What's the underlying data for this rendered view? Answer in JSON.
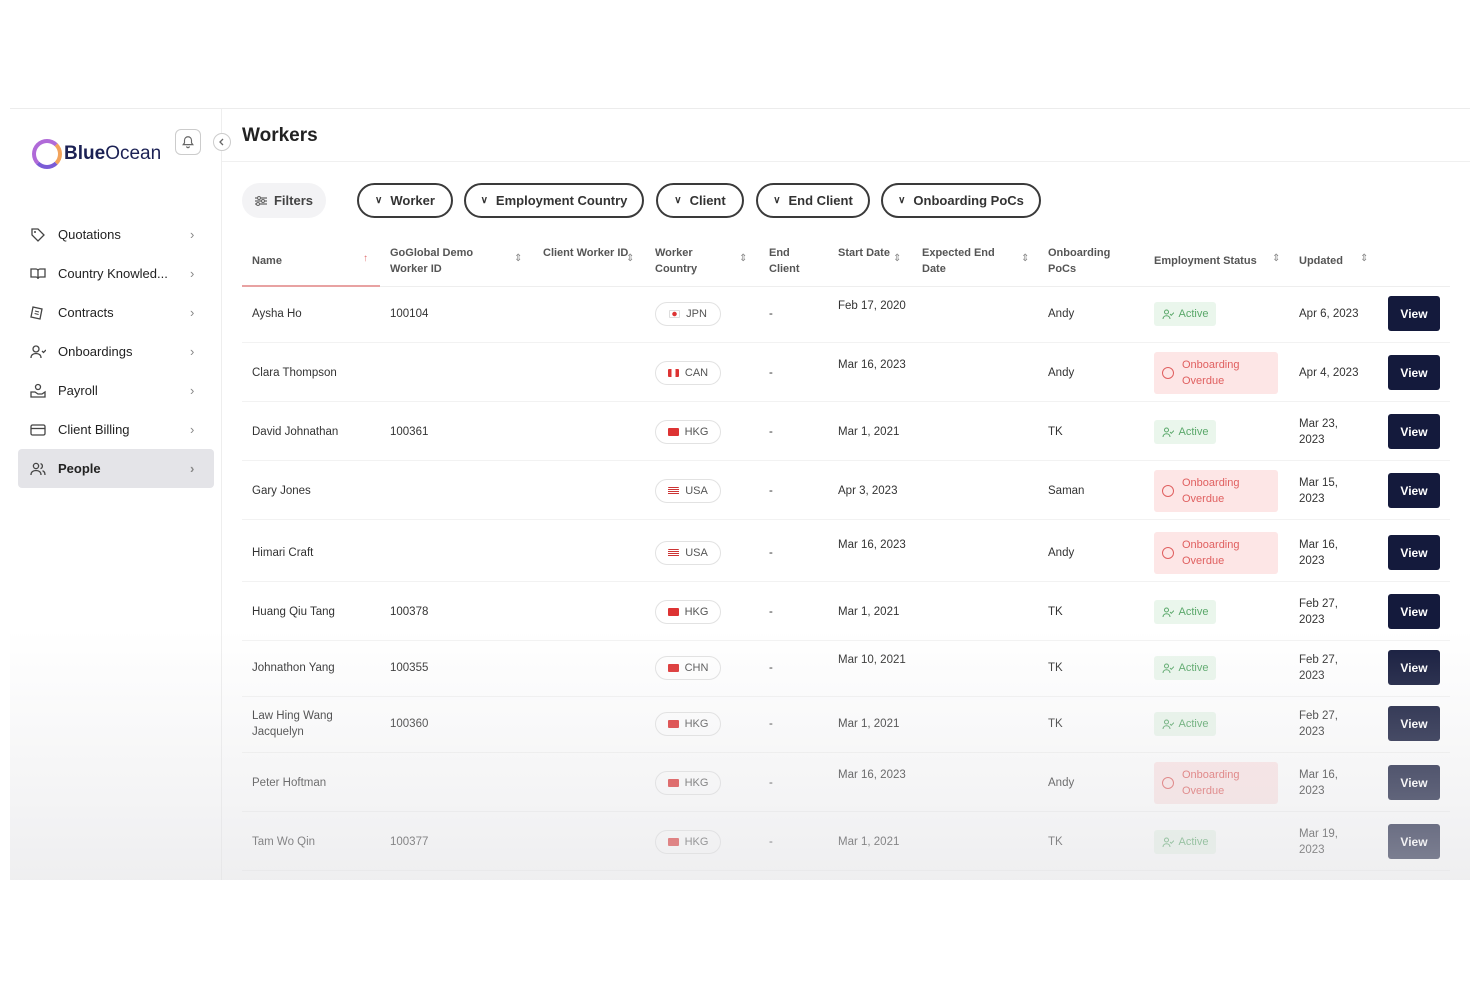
{
  "brand": {
    "name_bold": "Blue",
    "name_light": "Ocean"
  },
  "sidebar": {
    "items": [
      {
        "label": "Quotations",
        "icon": "tag-icon",
        "active": false
      },
      {
        "label": "Country Knowled...",
        "icon": "book-icon",
        "active": false
      },
      {
        "label": "Contracts",
        "icon": "contract-icon",
        "active": false
      },
      {
        "label": "Onboardings",
        "icon": "user-plus-icon",
        "active": false
      },
      {
        "label": "Payroll",
        "icon": "payroll-icon",
        "active": false
      },
      {
        "label": "Client Billing",
        "icon": "card-icon",
        "active": false
      },
      {
        "label": "People",
        "icon": "people-icon",
        "active": true
      }
    ]
  },
  "page": {
    "title": "Workers"
  },
  "filters": {
    "label": "Filters",
    "buttons": [
      "Worker",
      "Employment Country",
      "Client",
      "End Client",
      "Onboarding PoCs"
    ]
  },
  "table": {
    "headers": [
      "Name",
      "GoGlobal Demo Worker ID",
      "Client Worker ID",
      "Worker Country",
      "End Client",
      "Start Date",
      "Expected End Date",
      "Onboarding PoCs",
      "Employment Status",
      "Updated"
    ],
    "view_label": "View",
    "rows": [
      {
        "name": "Aysha Ho",
        "worker_id": "100104",
        "client_worker_id": "",
        "country": "JPN",
        "end_client": "-",
        "start_date": "Feb 17, 2020",
        "expected_end": "",
        "pocs": "Andy",
        "status": "Active",
        "updated": "Apr 6, 2023"
      },
      {
        "name": "Clara Thompson",
        "worker_id": "",
        "client_worker_id": "",
        "country": "CAN",
        "end_client": "-",
        "start_date": "Mar 16, 2023",
        "expected_end": "",
        "pocs": "Andy",
        "status": "Onboarding Overdue",
        "updated": "Apr 4, 2023"
      },
      {
        "name": "David Johnathan",
        "worker_id": "100361",
        "client_worker_id": "",
        "country": "HKG",
        "end_client": "-",
        "start_date": "Mar 1, 2021",
        "expected_end": "",
        "pocs": "TK",
        "status": "Active",
        "updated": "Mar 23, 2023"
      },
      {
        "name": "Gary Jones",
        "worker_id": "",
        "client_worker_id": "",
        "country": "USA",
        "end_client": "-",
        "start_date": "Apr 3, 2023",
        "expected_end": "",
        "pocs": "Saman",
        "status": "Onboarding Overdue",
        "updated": "Mar 15, 2023"
      },
      {
        "name": "Himari Craft",
        "worker_id": "",
        "client_worker_id": "",
        "country": "USA",
        "end_client": "-",
        "start_date": "Mar 16, 2023",
        "expected_end": "",
        "pocs": "Andy",
        "status": "Onboarding Overdue",
        "updated": "Mar 16, 2023"
      },
      {
        "name": "Huang Qiu Tang",
        "worker_id": "100378",
        "client_worker_id": "",
        "country": "HKG",
        "end_client": "-",
        "start_date": "Mar 1, 2021",
        "expected_end": "",
        "pocs": "TK",
        "status": "Active",
        "updated": "Feb 27, 2023"
      },
      {
        "name": "Johnathon Yang",
        "worker_id": "100355",
        "client_worker_id": "",
        "country": "CHN",
        "end_client": "-",
        "start_date": "Mar 10, 2021",
        "expected_end": "",
        "pocs": "TK",
        "status": "Active",
        "updated": "Feb 27, 2023"
      },
      {
        "name": "Law Hing Wang Jacquelyn",
        "worker_id": "100360",
        "client_worker_id": "",
        "country": "HKG",
        "end_client": "-",
        "start_date": "Mar 1, 2021",
        "expected_end": "",
        "pocs": "TK",
        "status": "Active",
        "updated": "Feb 27, 2023"
      },
      {
        "name": "Peter Hoftman",
        "worker_id": "",
        "client_worker_id": "",
        "country": "HKG",
        "end_client": "-",
        "start_date": "Mar 16, 2023",
        "expected_end": "",
        "pocs": "Andy",
        "status": "Onboarding Overdue",
        "updated": "Mar 16, 2023"
      },
      {
        "name": "Tam Wo Qin",
        "worker_id": "100377",
        "client_worker_id": "",
        "country": "HKG",
        "end_client": "-",
        "start_date": "Mar 1, 2021",
        "expected_end": "",
        "pocs": "TK",
        "status": "Active",
        "updated": "Mar 19, 2023"
      }
    ]
  },
  "colors": {
    "navy": "#141a3c",
    "active_bg": "#eaf6ec",
    "active_fg": "#5aa86a",
    "overdue_bg": "#fde6e6",
    "overdue_fg": "#e06060"
  }
}
